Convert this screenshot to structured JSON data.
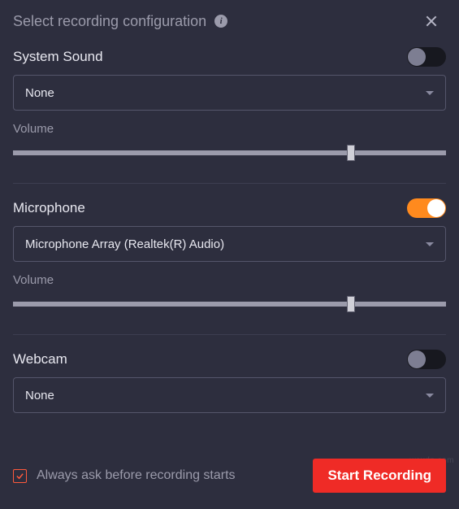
{
  "header": {
    "title": "Select recording configuration"
  },
  "system_sound": {
    "label": "System Sound",
    "enabled": false,
    "selected": "None",
    "volume_label": "Volume",
    "volume_percent": 78
  },
  "microphone": {
    "label": "Microphone",
    "enabled": true,
    "selected": "Microphone Array (Realtek(R) Audio)",
    "volume_label": "Volume",
    "volume_percent": 78
  },
  "webcam": {
    "label": "Webcam",
    "enabled": false,
    "selected": "None"
  },
  "footer": {
    "always_ask_label": "Always ask before recording starts",
    "always_ask_checked": true,
    "start_label": "Start Recording"
  },
  "colors": {
    "accent_toggle_on": "#ff8a1e",
    "primary_button": "#ef2b26",
    "checkbox_border": "#ff5a3c",
    "background": "#2d2e3e"
  },
  "watermark": "wsxdn.com"
}
